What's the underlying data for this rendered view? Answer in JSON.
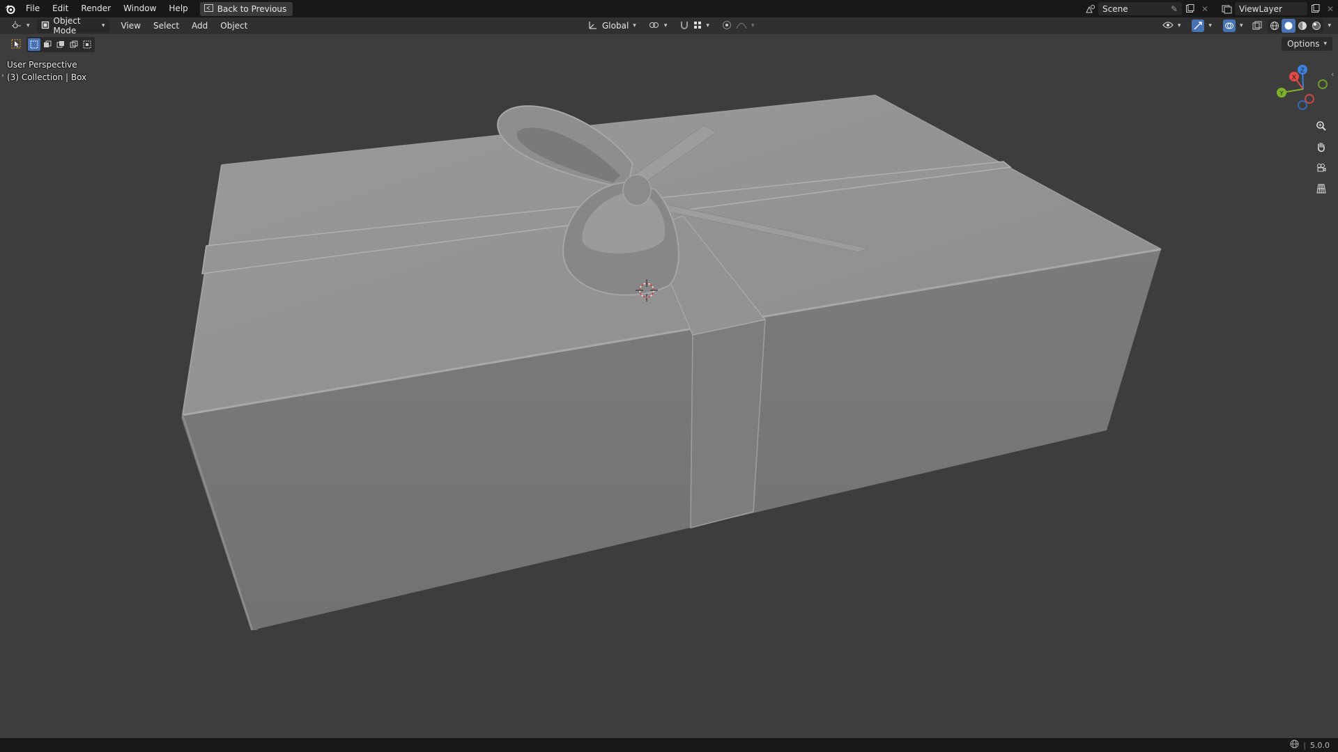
{
  "topbar": {
    "menus": [
      "File",
      "Edit",
      "Render",
      "Window",
      "Help"
    ],
    "back_button": "Back to Previous",
    "scene_name": "Scene",
    "view_layer": "ViewLayer"
  },
  "header": {
    "mode": "Object Mode",
    "menus": [
      "View",
      "Select",
      "Add",
      "Object"
    ],
    "transform_orientation": "Global",
    "options_label": "Options"
  },
  "viewport": {
    "perspective_label": "User Perspective",
    "collection_label": "(3) Collection | Box"
  },
  "gizmo": {
    "x_label": "X",
    "y_label": "Y",
    "z_label": "Z",
    "x_color": "#e04a4a",
    "y_color": "#7eb22a",
    "z_color": "#3b82e0"
  },
  "statusbar": {
    "version": "5.0.0"
  }
}
